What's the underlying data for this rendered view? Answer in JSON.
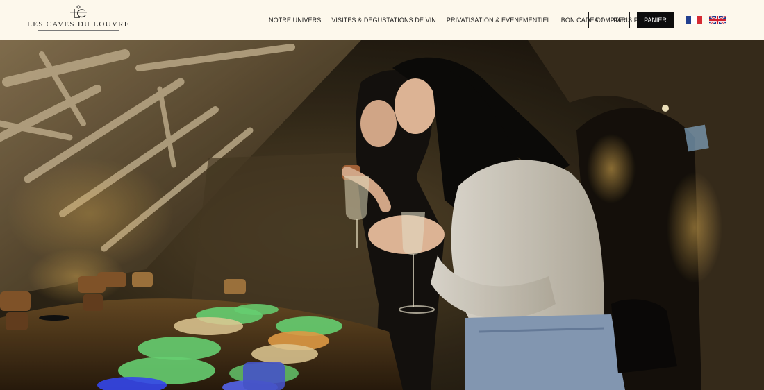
{
  "logo": {
    "monogram": "LC",
    "text": "LES CAVES DU LOUVRE"
  },
  "nav": {
    "items": [
      {
        "label": "NOTRE UNIVERS"
      },
      {
        "label": "VISITES & DÉGUSTATIONS DE VIN"
      },
      {
        "label": "PRIVATISATION & EVENEMENTIEL"
      },
      {
        "label": "BON CADEAU"
      },
      {
        "label": "PARIS PASS"
      }
    ]
  },
  "account": {
    "label": "COMPTE"
  },
  "cart": {
    "label": "PANIER"
  },
  "languages": [
    {
      "name": "flag-fr-icon",
      "colors": [
        "#22408f",
        "#ffffff",
        "#d62b33"
      ]
    },
    {
      "name": "flag-uk-icon",
      "colors": [
        "#1f3a8a",
        "#ffffff",
        "#cf1f2e"
      ]
    }
  ],
  "colors": {
    "header_bg": "#fdf8ec",
    "text": "#1a1a1a",
    "button_dark": "#0d0d0d"
  }
}
